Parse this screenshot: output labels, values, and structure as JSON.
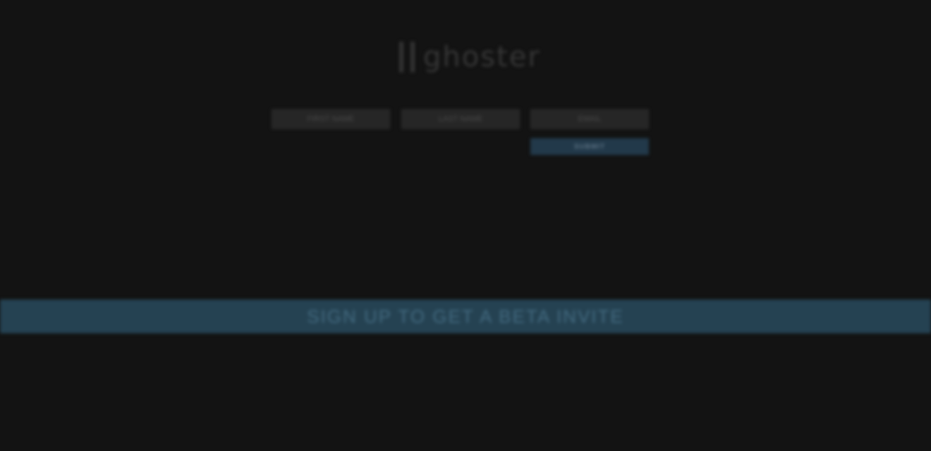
{
  "logo": {
    "text": "ghoster"
  },
  "form": {
    "first_name_placeholder": "FIRST NAME",
    "last_name_placeholder": "LAST NAME",
    "email_placeholder": "EMAIL",
    "submit_label": "SUBMIT"
  },
  "banner": {
    "text": "SIGN UP TO GET A BETA INVITE"
  },
  "colors": {
    "background": "#131313",
    "field_background": "#262626",
    "accent": "#254252",
    "accent_text": "#436a80"
  }
}
